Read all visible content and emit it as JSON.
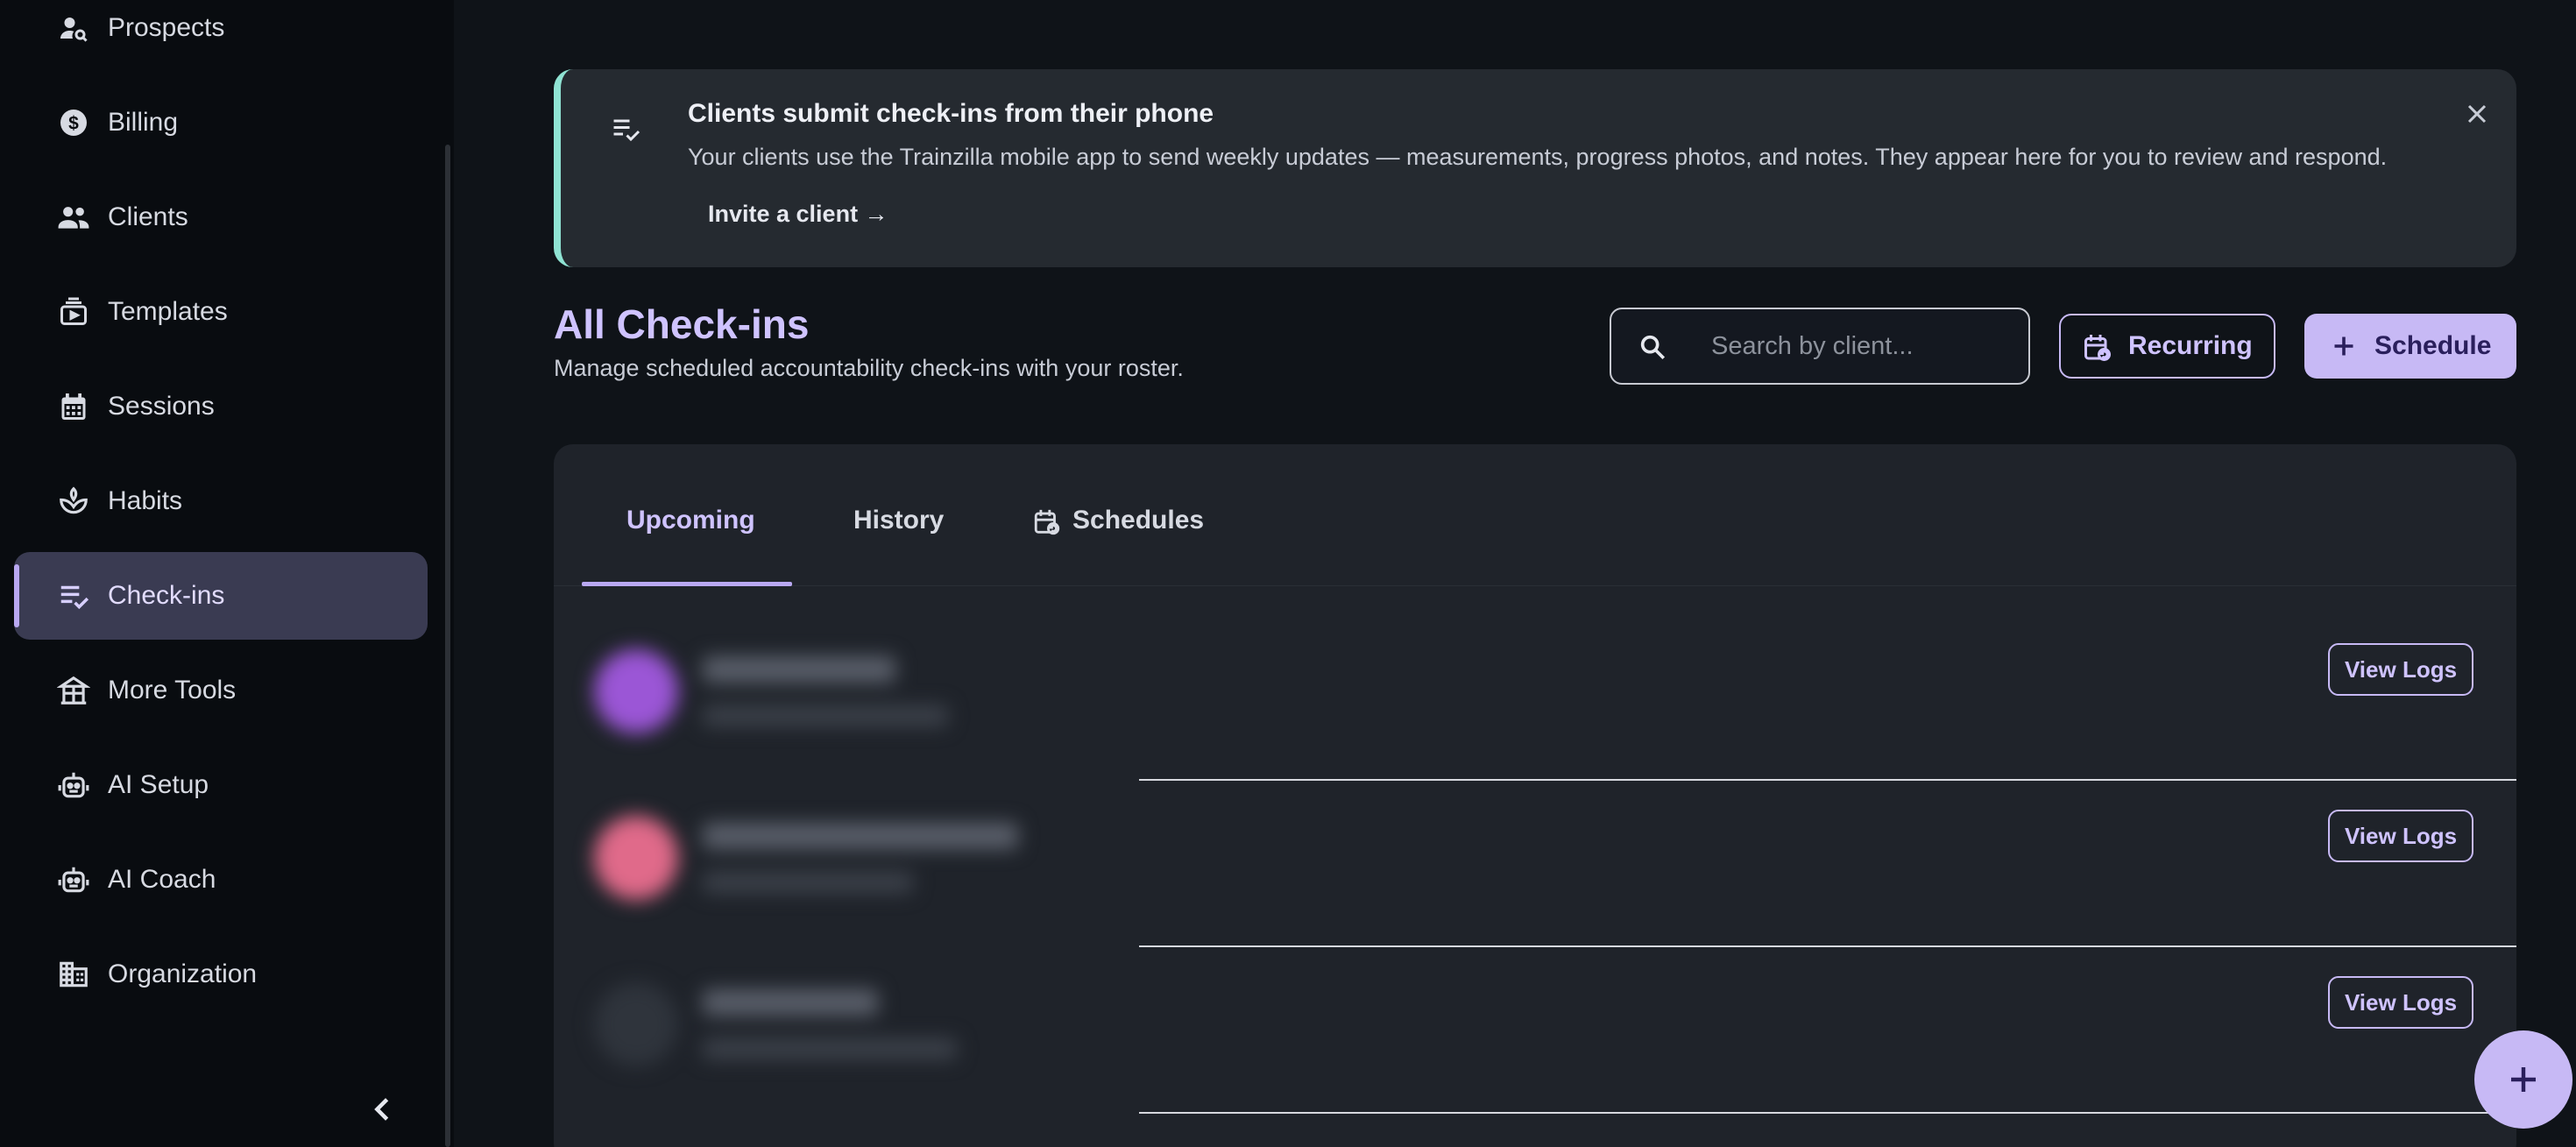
{
  "sidebar": {
    "items": [
      {
        "label": "Prospects",
        "icon": "prospects-icon"
      },
      {
        "label": "Billing",
        "icon": "billing-icon"
      },
      {
        "label": "Clients",
        "icon": "clients-icon"
      },
      {
        "label": "Templates",
        "icon": "templates-icon"
      },
      {
        "label": "Sessions",
        "icon": "calendar-icon"
      },
      {
        "label": "Habits",
        "icon": "habits-icon"
      },
      {
        "label": "Check-ins",
        "icon": "checklist-icon",
        "active": true
      },
      {
        "label": "More Tools",
        "icon": "tools-icon"
      },
      {
        "label": "AI Setup",
        "icon": "robot-icon"
      },
      {
        "label": "AI Coach",
        "icon": "robot-icon"
      },
      {
        "label": "Organization",
        "icon": "organization-icon"
      }
    ],
    "collapse_icon": "chevron-left-icon"
  },
  "banner": {
    "title": "Clients submit check-ins from their phone",
    "description": "Your clients use the Trainzilla mobile app to send weekly updates — measurements, progress photos, and notes. They appear here for you to review and respond.",
    "link": "Invite a client →",
    "accent_color": "#8fe3d3"
  },
  "header": {
    "title": "All Check-ins",
    "subtitle": "Manage scheduled accountability check-ins with your roster."
  },
  "search": {
    "placeholder": "Search by client...",
    "value": ""
  },
  "actions": {
    "recurring": "Recurring",
    "schedule": "Schedule"
  },
  "tabs": [
    {
      "label": "Upcoming",
      "active": true
    },
    {
      "label": "History",
      "active": false
    },
    {
      "label": "Schedules",
      "active": false
    }
  ],
  "rows": [
    {
      "avatar_color": "#9b56d6",
      "action": "View Logs"
    },
    {
      "avatar_color": "#e06a8a",
      "action": "View Logs"
    },
    {
      "avatar_color": "#2f343c",
      "action": "View Logs"
    }
  ],
  "colors": {
    "accent": "#c7b9f5",
    "accent_text": "#cfc3ff",
    "active_nav": "#3a3b52"
  }
}
